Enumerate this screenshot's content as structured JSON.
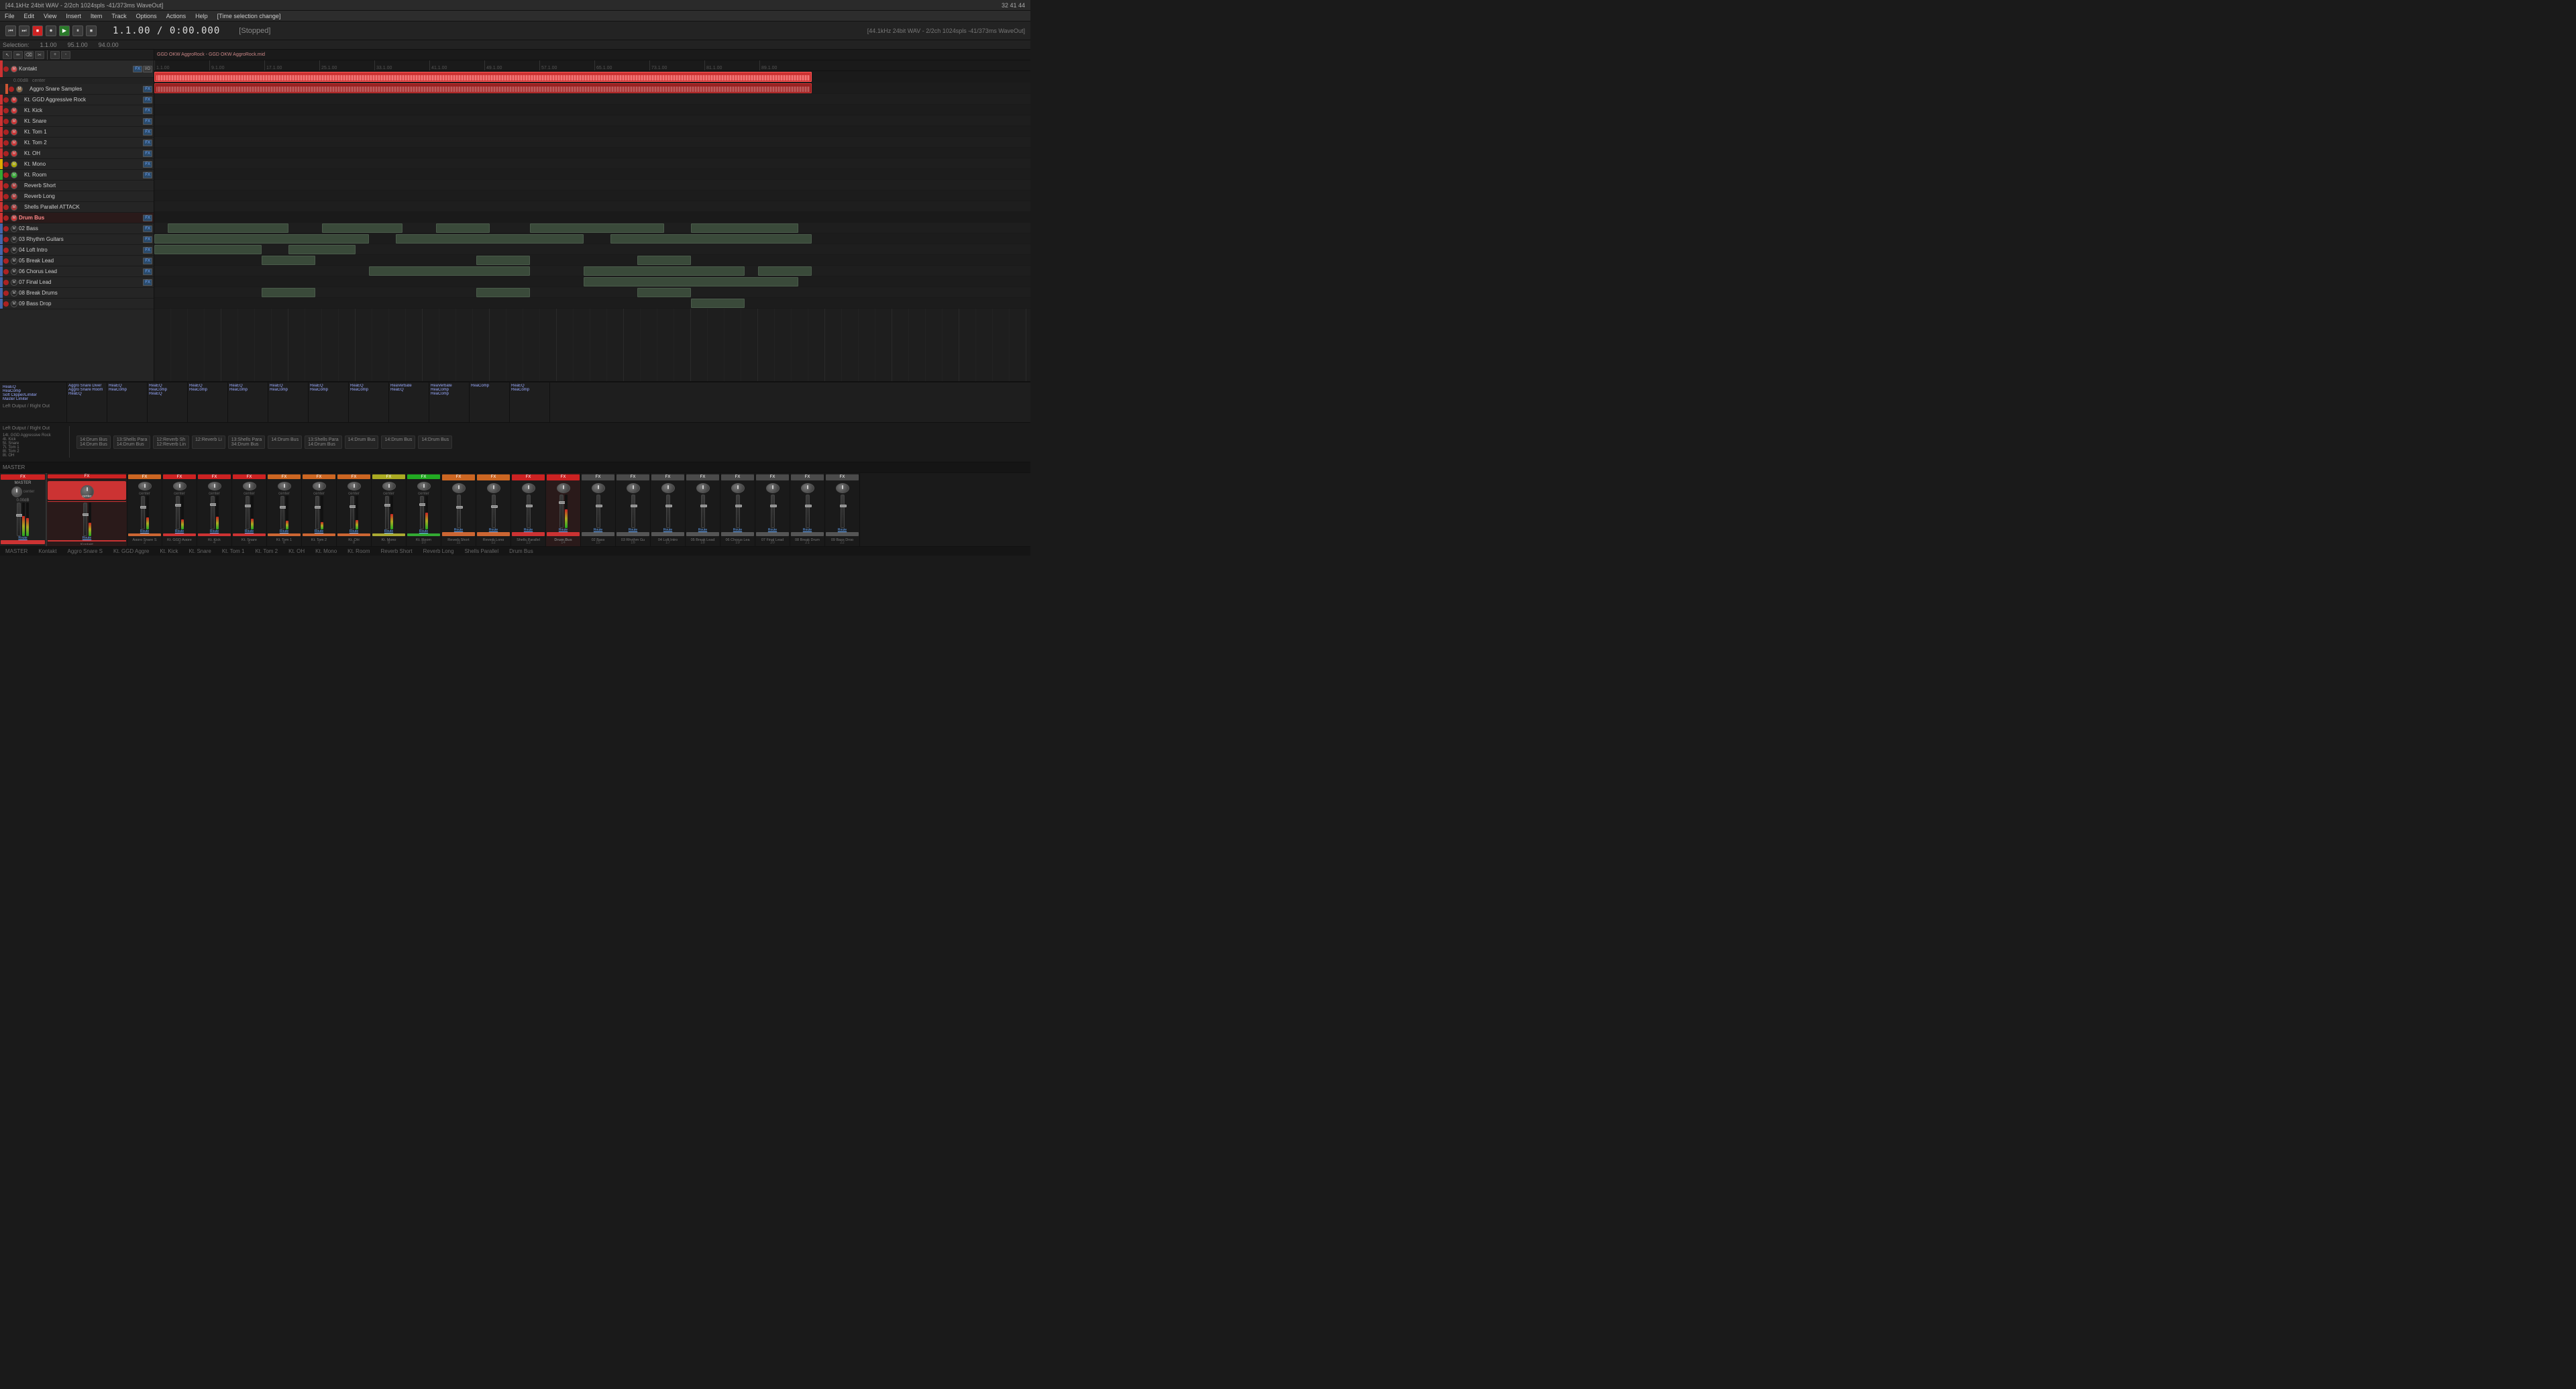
{
  "titleBar": {
    "left": "[44.1kHz 24bit WAV - 2/2ch 1024spls -41/373ms WaveOut]",
    "right": "32  41  44"
  },
  "menuBar": {
    "items": [
      "File",
      "Edit",
      "View",
      "Insert",
      "Item",
      "Track",
      "Options",
      "Actions",
      "Help",
      "[Time selection change]"
    ]
  },
  "selectionBar": {
    "selection": "Selection:",
    "start": "1.1.00",
    "end": "95.1.00",
    "length": "94.0.00"
  },
  "transport": {
    "timeDisplay": "1.1.00 / 0:00.000",
    "status": "[Stopped]",
    "buttons": [
      "⏮",
      "⏭",
      "⏹",
      "⏺",
      "▶",
      "⏸",
      "⏹"
    ]
  },
  "tracks": [
    {
      "id": 1,
      "name": "Kontakt",
      "color": "#cc3333",
      "type": "instrument",
      "volume": "0.00dB",
      "pan": "center",
      "num": "",
      "group": true,
      "expanded": true
    },
    {
      "id": 2,
      "name": "Aggro Snare Samples",
      "color": "#cc5533",
      "type": "instrument",
      "indent": true,
      "num": ""
    },
    {
      "id": 3,
      "name": "Kt. GGD Aggressive Rock",
      "color": "#cc3333",
      "type": "instrument",
      "indent": true
    },
    {
      "id": 4,
      "name": "Kt. Kick",
      "color": "#cc3333",
      "type": "instrument",
      "indent": true
    },
    {
      "id": 5,
      "name": "Kt. Snare",
      "color": "#cc3333",
      "type": "instrument",
      "indent": true
    },
    {
      "id": 6,
      "name": "Kt. Tom 1",
      "color": "#cc3333",
      "type": "instrument",
      "indent": true
    },
    {
      "id": 7,
      "name": "Kt. Tom 2",
      "color": "#cc3333",
      "type": "instrument",
      "indent": true
    },
    {
      "id": 8,
      "name": "Kt. OH",
      "color": "#cc3333",
      "type": "instrument",
      "indent": true
    },
    {
      "id": 9,
      "name": "Kt. Mono",
      "color": "#ddaa00",
      "type": "instrument",
      "indent": true
    },
    {
      "id": 10,
      "name": "Kt. Room",
      "color": "#33aa33",
      "type": "instrument",
      "indent": true
    },
    {
      "id": 11,
      "name": "Reverb Short",
      "color": "#cc3333",
      "type": "fx",
      "indent": true
    },
    {
      "id": 12,
      "name": "Reverb Long",
      "color": "#cc3333",
      "type": "fx",
      "indent": true
    },
    {
      "id": 13,
      "name": "Shells Parallel ATTACK",
      "color": "#cc3333",
      "type": "fx",
      "indent": true
    },
    {
      "id": 14,
      "name": "Drum Bus",
      "color": "#cc3333",
      "type": "bus",
      "indent": false,
      "bold": true
    },
    {
      "id": 15,
      "name": "02 Bass",
      "color": "#444488",
      "type": "midi"
    },
    {
      "id": 16,
      "name": "03 Rhythm Guitars",
      "color": "#444488",
      "type": "midi"
    },
    {
      "id": 17,
      "name": "04 Loft Intro",
      "color": "#444488",
      "type": "midi"
    },
    {
      "id": 18,
      "name": "05 Break Lead",
      "color": "#444488",
      "type": "midi"
    },
    {
      "id": 19,
      "name": "06 Chorus Lead",
      "color": "#444488",
      "type": "midi"
    },
    {
      "id": 20,
      "name": "07 Final Lead",
      "color": "#444488",
      "type": "midi"
    },
    {
      "id": 21,
      "name": "08 Break Drums",
      "color": "#444488",
      "type": "midi"
    },
    {
      "id": 22,
      "name": "09 Bass Drop",
      "color": "#444488",
      "type": "midi"
    }
  ],
  "fxChain": {
    "tracks": [
      {
        "name": "Kontakt",
        "plugins": [
          "ReaEQ",
          "ReaComp",
          "Soft Clipper/Limiter",
          "Master Limiter"
        ]
      },
      {
        "name": "",
        "plugins": [
          "Aggro Snare Diver",
          "Aggro Snare Room",
          "ReaEQ"
        ]
      },
      {
        "name": "",
        "plugins": [
          "ReaEQ",
          "ReaComp"
        ]
      },
      {
        "name": "",
        "plugins": [
          "ReaEQ",
          "ReaComp",
          "ReaEQ"
        ]
      },
      {
        "name": "",
        "plugins": [
          "ReaEQ",
          "ReaComp"
        ]
      },
      {
        "name": "",
        "plugins": [
          "ReaEQ",
          "ReaComp"
        ]
      },
      {
        "name": "",
        "plugins": [
          "ReaEQ",
          "ReaComp"
        ]
      },
      {
        "name": "",
        "plugins": [
          "ReaEQ",
          "ReaComp"
        ]
      },
      {
        "name": "",
        "plugins": [
          "ReaEQ",
          "ReaComp"
        ]
      },
      {
        "name": "",
        "plugins": [
          "ReaVerbate",
          "ReaEQ"
        ]
      },
      {
        "name": "",
        "plugins": [
          "ReaVerbate",
          "ReaComp",
          "ReaComp"
        ]
      },
      {
        "name": "",
        "plugins": [
          "ReaComp"
        ]
      },
      {
        "name": "",
        "plugins": [
          "ReaEQ",
          "ReaComp"
        ]
      }
    ]
  },
  "routing": {
    "ioLabel": "Left Output / Right Out",
    "sends": [
      "14t. GGD Aggressive Rock",
      "4t. Kick",
      "5t. Snare",
      "7t. Tom 1",
      "8t. Tom 2",
      "8t. OH"
    ],
    "routeLabels": [
      {
        "text": "14:Drum Bus",
        "sub": "14:Drum Bus"
      },
      {
        "text": "13:Shells Para",
        "sub": "14:Drum Bus"
      },
      {
        "text": "12:Reverb Sh",
        "sub": "12:Reverb Lin"
      },
      {
        "text": "12:Reverb Li",
        "sub": ""
      },
      {
        "text": "13:Shells Para",
        "sub": "34:Drum Bus"
      },
      {
        "text": "14:Drum Bus",
        "sub": ""
      },
      {
        "text": "13:Shells Para",
        "sub": "14:Drum Bus"
      },
      {
        "text": "14:Drum Bus",
        "sub": ""
      },
      {
        "text": "14:Drum Bus",
        "sub": ""
      },
      {
        "text": "14:Drum Bus",
        "sub": ""
      }
    ]
  },
  "mixer": {
    "masterLabel": "MASTER",
    "channels": [
      {
        "num": "",
        "name": "Kontakt",
        "color": "red",
        "faderPos": 70,
        "meterLevel": 40,
        "pan": "center"
      },
      {
        "num": "2",
        "name": "Aggro Snare S",
        "color": "orange",
        "faderPos": 65,
        "meterLevel": 35,
        "pan": "center"
      },
      {
        "num": "3",
        "name": "Kt. GGD Aggre",
        "color": "red",
        "faderPos": 70,
        "meterLevel": 30,
        "pan": "center"
      },
      {
        "num": "4",
        "name": "Kt. Kick",
        "color": "red",
        "faderPos": 72,
        "meterLevel": 38,
        "pan": "center"
      },
      {
        "num": "5",
        "name": "Kt. Snare",
        "color": "red",
        "faderPos": 68,
        "meterLevel": 32,
        "pan": "center"
      },
      {
        "num": "6",
        "name": "Kt. Tom 1",
        "color": "orange",
        "faderPos": 65,
        "meterLevel": 28,
        "pan": "center"
      },
      {
        "num": "7",
        "name": "Kt. Tom 2",
        "color": "orange",
        "faderPos": 65,
        "meterLevel": 25,
        "pan": "center"
      },
      {
        "num": "8",
        "name": "Kt. OH",
        "color": "orange",
        "faderPos": 67,
        "meterLevel": 30,
        "pan": "center"
      },
      {
        "num": "9",
        "name": "Kt. Mono",
        "color": "yellow",
        "faderPos": 70,
        "meterLevel": 45,
        "pan": "center"
      },
      {
        "num": "10",
        "name": "Kt. Room",
        "color": "green",
        "faderPos": 72,
        "meterLevel": 50,
        "pan": "center"
      },
      {
        "num": "11",
        "name": "Reverb Short",
        "color": "orange",
        "faderPos": 60,
        "meterLevel": 20,
        "pan": "center"
      },
      {
        "num": "12",
        "name": "Reverb Long",
        "color": "orange",
        "faderPos": 62,
        "meterLevel": 22,
        "pan": "center"
      },
      {
        "num": "13",
        "name": "Shells Parallel",
        "color": "red",
        "faderPos": 65,
        "meterLevel": 28,
        "pan": "center"
      },
      {
        "num": "14",
        "name": "Drum Bus",
        "color": "red",
        "faderPos": 75,
        "meterLevel": 55,
        "pan": "center"
      },
      {
        "num": "15",
        "name": "02 Bass",
        "color": "gray",
        "faderPos": 65,
        "meterLevel": 0,
        "pan": "center"
      },
      {
        "num": "16",
        "name": "03 Rhythm Gu",
        "color": "gray",
        "faderPos": 65,
        "meterLevel": 0,
        "pan": "center"
      },
      {
        "num": "17",
        "name": "04 Loft Intro",
        "color": "gray",
        "faderPos": 65,
        "meterLevel": 0,
        "pan": "center"
      },
      {
        "num": "18",
        "name": "05 Break Lead",
        "color": "gray",
        "faderPos": 65,
        "meterLevel": 0,
        "pan": "center"
      },
      {
        "num": "19",
        "name": "06 Chorus Lea",
        "color": "gray",
        "faderPos": 65,
        "meterLevel": 0,
        "pan": "center"
      },
      {
        "num": "20",
        "name": "07 Final Lead",
        "color": "gray",
        "faderPos": 65,
        "meterLevel": 0,
        "pan": "center"
      },
      {
        "num": "21",
        "name": "08 Break Drum",
        "color": "gray",
        "faderPos": 65,
        "meterLevel": 0,
        "pan": "center"
      },
      {
        "num": "22",
        "name": "09 Bass Drop",
        "color": "gray",
        "faderPos": 65,
        "meterLevel": 0,
        "pan": "center"
      }
    ],
    "routeButtonLabel": "Route",
    "bottomLabels": [
      "",
      "Aggro Snare S",
      "Kt. GGD Aggre",
      "Kt. Kick",
      "Kt. Snare",
      "Kt. Tom 1",
      "Kt. Tom 2",
      "Kt. OH",
      "Kt. Mono",
      "Kt. Room",
      "Reverb Short",
      "Reverb Long",
      "Shells Parallel",
      "Drum Bus",
      "02 Bass",
      "03 Rhythm Gu",
      "04 Loft Intro",
      "05 Break Lead",
      "06 Chorus Lea",
      "07 Final Lead",
      "08 Break Drum",
      "09 Bass Drop"
    ],
    "bottomNumbers": [
      "",
      "2",
      "3",
      "4",
      "5",
      "6",
      "7",
      "8",
      "9",
      "10",
      "11",
      "12",
      "13",
      "14",
      "15",
      "16",
      "17",
      "18",
      "19",
      "20",
      "21",
      "22"
    ]
  }
}
